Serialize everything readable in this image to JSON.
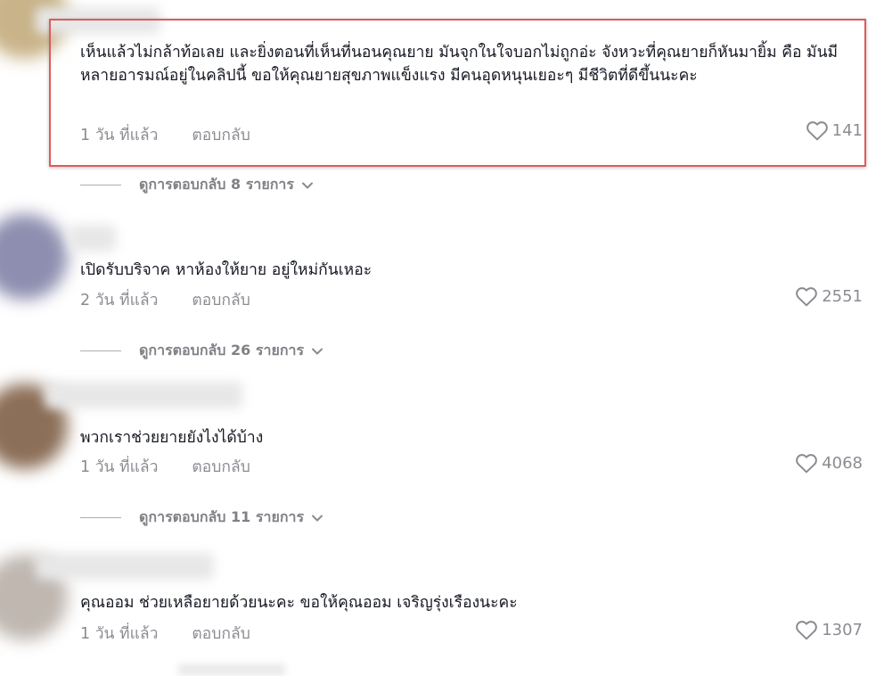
{
  "comments": [
    {
      "text": "เห็นแล้วไม่กล้าท้อเลย และยิ่งตอนที่เห็นที่นอนคุณยาย มันจุกในใจบอกไม่ถูกอ่ะ จังหวะที่คุณยายก็หันมายิ้ม คือ มันมีหลายอารมณ์อยู่ในคลิปนี้ ขอให้คุณยายสุขภาพแข็งแรง มีคนอุดหนุนเยอะๆ มีชีวิตที่ดีขึ้นนะคะ",
      "time": "1 วัน ที่แล้ว",
      "reply_label": "ตอบกลับ",
      "likes": "141",
      "view_replies": "ดูการตอบกลับ 8 รายการ",
      "highlighted": true
    },
    {
      "text": "เปิดรับบริจาค หาห้องให้ยาย อยู่ใหม่กันเหอะ",
      "time": "2 วัน ที่แล้ว",
      "reply_label": "ตอบกลับ",
      "likes": "2551",
      "view_replies": "ดูการตอบกลับ 26 รายการ"
    },
    {
      "text": "พวกเราช่วยยายยังไงได้บ้าง",
      "time": "1 วัน ที่แล้ว",
      "reply_label": "ตอบกลับ",
      "likes": "4068",
      "view_replies": "ดูการตอบกลับ 11 รายการ"
    },
    {
      "text": "คุณออม ช่วยเหลือยายด้วยนะคะ ขอให้คุณออม เจริญรุ่งเรืองนะคะ",
      "time": "1 วัน ที่แล้ว",
      "reply_label": "ตอบกลับ",
      "likes": "1307"
    }
  ],
  "icons": {
    "like": "heart-outline-icon",
    "expand": "chevron-down-icon"
  },
  "colors": {
    "highlight_border": "#e05a5a",
    "text_primary": "#161823",
    "text_secondary": "#8a8b91"
  }
}
